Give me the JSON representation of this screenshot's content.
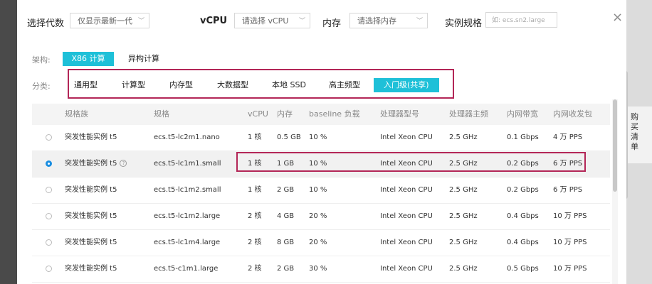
{
  "background": {
    "right_panel": [
      "购",
      "买",
      "清",
      "单"
    ]
  },
  "header": {
    "gen_label": "选择代数",
    "gen_value": "仅显示最新一代",
    "vcpu_label": "vCPU",
    "vcpu_placeholder": "请选择 vCPU",
    "mem_label": "内存",
    "mem_placeholder": "请选择内存",
    "spec_label": "实例规格",
    "spec_placeholder": "如: ecs.sn2.large",
    "close_symbol": "×"
  },
  "arch": {
    "label": "架构:",
    "options": [
      "X86 计算",
      "异构计算"
    ],
    "active": 0
  },
  "category": {
    "label": "分类:",
    "options": [
      "通用型",
      "计算型",
      "内存型",
      "大数据型",
      "本地 SSD",
      "高主频型",
      "入门级(共享)"
    ],
    "active": 6
  },
  "table": {
    "columns": [
      "规格族",
      "规格",
      "vCPU",
      "内存",
      "baseline 负载",
      "处理器型号",
      "处理器主频",
      "内网带宽",
      "内网收发包"
    ],
    "rows": [
      {
        "family": "突发性能实例 t5",
        "spec": "ecs.t5-lc2m1.nano",
        "vcpu": "1 核",
        "mem": "0.5 GB",
        "baseline": "10 %",
        "cpu": "Intel Xeon CPU",
        "freq": "2.5 GHz",
        "bw": "0.1 Gbps",
        "pps": "4 万 PPS",
        "selected": false
      },
      {
        "family": "突发性能实例 t5",
        "spec": "ecs.t5-lc1m1.small",
        "vcpu": "1 核",
        "mem": "1 GB",
        "baseline": "10 %",
        "cpu": "Intel Xeon CPU",
        "freq": "2.5 GHz",
        "bw": "0.2 Gbps",
        "pps": "6 万 PPS",
        "selected": true
      },
      {
        "family": "突发性能实例 t5",
        "spec": "ecs.t5-lc1m2.small",
        "vcpu": "1 核",
        "mem": "2 GB",
        "baseline": "10 %",
        "cpu": "Intel Xeon CPU",
        "freq": "2.5 GHz",
        "bw": "0.2 Gbps",
        "pps": "6 万 PPS",
        "selected": false
      },
      {
        "family": "突发性能实例 t5",
        "spec": "ecs.t5-lc1m2.large",
        "vcpu": "2 核",
        "mem": "4 GB",
        "baseline": "20 %",
        "cpu": "Intel Xeon CPU",
        "freq": "2.5 GHz",
        "bw": "0.4 Gbps",
        "pps": "10 万 PPS",
        "selected": false
      },
      {
        "family": "突发性能实例 t5",
        "spec": "ecs.t5-lc1m4.large",
        "vcpu": "2 核",
        "mem": "8 GB",
        "baseline": "20 %",
        "cpu": "Intel Xeon CPU",
        "freq": "2.5 GHz",
        "bw": "0.4 Gbps",
        "pps": "10 万 PPS",
        "selected": false
      },
      {
        "family": "突发性能实例 t5",
        "spec": "ecs.t5-c1m1.large",
        "vcpu": "2 核",
        "mem": "2 GB",
        "baseline": "30 %",
        "cpu": "Intel Xeon CPU",
        "freq": "2.5 GHz",
        "bw": "0.5 Gbps",
        "pps": "10 万 PPS",
        "selected": false
      }
    ]
  },
  "colors": {
    "accent": "#1ec0d8",
    "radio_checked": "#1a8ee1",
    "highlight_box": "#b32657"
  }
}
